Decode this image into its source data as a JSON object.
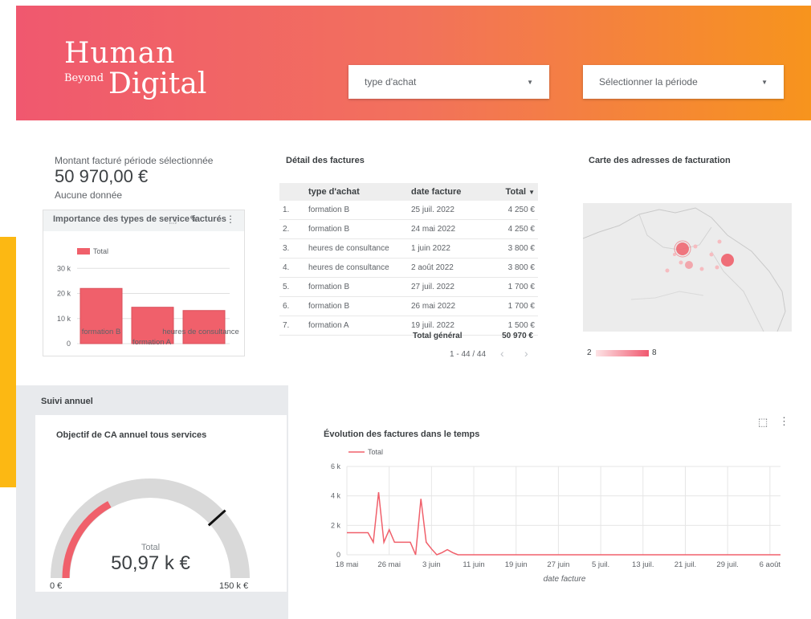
{
  "header": {
    "logo": {
      "line1": "Human",
      "line2": "Beyond",
      "line3": "Digital"
    },
    "filter_type": {
      "label": "type d'achat"
    },
    "filter_period": {
      "label": "Sélectionner la période"
    }
  },
  "kpi": {
    "label": "Montant facturé période sélectionnée",
    "value": "50 970,00 €",
    "sub": "Aucune donnée"
  },
  "bar_chart_card": {
    "title": "Importance des types de service facturés"
  },
  "invoices": {
    "title": "Détail des factures",
    "columns": [
      "type d'achat",
      "date facture",
      "Total"
    ],
    "rows": [
      {
        "n": "1.",
        "type": "formation B",
        "date": "25 juil. 2022",
        "total": "4 250 €"
      },
      {
        "n": "2.",
        "type": "formation B",
        "date": "24 mai 2022",
        "total": "4 250 €"
      },
      {
        "n": "3.",
        "type": "heures de consultance",
        "date": "1 juin 2022",
        "total": "3 800 €"
      },
      {
        "n": "4.",
        "type": "heures de consultance",
        "date": "2 août 2022",
        "total": "3 800 €"
      },
      {
        "n": "5.",
        "type": "formation B",
        "date": "27 juil. 2022",
        "total": "1 700 €"
      },
      {
        "n": "6.",
        "type": "formation B",
        "date": "26 mai 2022",
        "total": "1 700 €"
      },
      {
        "n": "7.",
        "type": "formation A",
        "date": "19 juil. 2022",
        "total": "1 500 €"
      }
    ],
    "total_label": "Total général",
    "total_value": "50 970 €",
    "pager": "1 - 44 / 44"
  },
  "map": {
    "title": "Carte des adresses de facturation",
    "legend_min": "2",
    "legend_max": "8"
  },
  "suivi": {
    "title": "Suivi annuel",
    "gauge": {
      "title": "Objectif de CA annuel tous services",
      "label": "Total",
      "value_text": "50,97 k €",
      "min_label": "0 €",
      "max_label": "150 k €",
      "value": 50.97,
      "target": 115,
      "max": 150
    }
  },
  "line_card": {
    "title": "Évolution des factures dans le temps"
  },
  "chart_data": [
    {
      "type": "bar",
      "categories": [
        "formation B",
        "formation A",
        "heures de consultance"
      ],
      "category_labels_shown": [
        "formation B",
        "heures de consultance",
        "formation A"
      ],
      "series": [
        {
          "name": "Total",
          "values": [
            22000,
            14500,
            13200
          ]
        }
      ],
      "yticks": [
        "30 k",
        "20 k",
        "10 k",
        "0"
      ],
      "ylim": [
        0,
        32000
      ],
      "color": "#f0606b",
      "legend": "top-left"
    },
    {
      "type": "line",
      "x": [
        "18 mai",
        "19 mai",
        "20 mai",
        "21 mai",
        "22 mai",
        "23 mai",
        "24 mai",
        "25 mai",
        "26 mai",
        "27 mai",
        "28 mai",
        "29 mai",
        "30 mai",
        "31 mai",
        "1 juin",
        "2 juin",
        "3 juin",
        "4 juin",
        "5 juin",
        "6 juin",
        "7 juin",
        "8 juin",
        "9 juin",
        "10 juin",
        "11 juin",
        "12 juin",
        "13 juin",
        "14 juin",
        "15 juin",
        "16 juin",
        "17 juin",
        "18 juin",
        "19 juin",
        "20 juin",
        "21 juin",
        "22 juin",
        "23 juin",
        "24 juin",
        "25 juin",
        "26 juin",
        "27 juin",
        "28 juin",
        "29 juin",
        "30 juin",
        "1 juil.",
        "2 juil.",
        "3 juil.",
        "4 juil.",
        "5 juil.",
        "6 juil.",
        "7 juil.",
        "8 juil.",
        "9 juil.",
        "10 juil.",
        "11 juil.",
        "12 juil.",
        "13 juil.",
        "14 juil.",
        "15 juil.",
        "16 juil.",
        "17 juil.",
        "18 juil.",
        "19 juil.",
        "20 juil.",
        "21 juil.",
        "22 juil.",
        "23 juil.",
        "24 juil.",
        "25 juil.",
        "26 juil.",
        "27 juil.",
        "28 juil.",
        "29 juil.",
        "30 juil.",
        "31 juil.",
        "1 août",
        "2 août",
        "3 août",
        "4 août",
        "5 août",
        "6 août",
        "7 août",
        "8 août"
      ],
      "series": [
        {
          "name": "Total",
          "values": [
            1500,
            1500,
            1500,
            1500,
            1500,
            850,
            4250,
            850,
            1700,
            850,
            850,
            850,
            850,
            0,
            3800,
            850,
            400,
            0,
            150,
            350,
            150,
            0,
            0,
            0,
            0,
            0,
            0,
            0,
            0,
            0,
            0,
            0,
            0,
            0,
            0,
            0,
            0,
            0,
            0,
            0,
            0,
            0,
            0,
            0,
            0,
            0,
            0,
            0,
            0,
            0,
            0,
            0,
            0,
            0,
            0,
            0,
            0,
            0,
            0,
            0,
            0,
            0,
            0,
            0,
            0,
            0,
            0,
            0,
            0,
            0,
            0,
            0,
            0,
            0,
            0,
            0,
            0,
            0,
            0,
            0,
            0,
            0,
            0
          ]
        }
      ],
      "xticks": [
        "18 mai",
        "26 mai",
        "3 juin",
        "11 juin",
        "19 juin",
        "27 juin",
        "5 juil.",
        "13 juil.",
        "21 juil.",
        "29 juil.",
        "6 août"
      ],
      "yticks": [
        "6 k",
        "4 k",
        "2 k",
        "0"
      ],
      "ylim": [
        0,
        6000
      ],
      "xlabel": "date facture",
      "color": "#f0606b",
      "legend": "top-left"
    }
  ]
}
